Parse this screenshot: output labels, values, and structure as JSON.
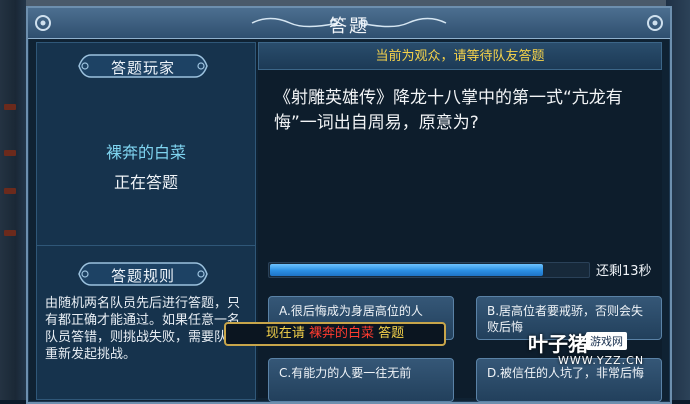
{
  "dialog": {
    "title": "答题"
  },
  "left_panel": {
    "player_header": "答题玩家",
    "player_name": "裸奔的白菜",
    "player_status": "正在答题",
    "rules_header": "答题规则",
    "rules_text": "由随机两名队员先后进行答题，只有都正确才能通过。如果任意一名队员答错，则挑战失败，需要队长重新发起挑战。"
  },
  "right_panel": {
    "notice": "当前为观众，请等待队友答题",
    "question": "《射雕英雄传》降龙十八掌中的第一式“亢龙有悔”一词出自周易，原意为?",
    "progress": 0.86,
    "time_left": "还剩13秒",
    "answers": [
      {
        "label": "A.很后悔成为身居高位的人"
      },
      {
        "label": "B.居高位者要戒骄，否则会失败后悔"
      },
      {
        "label": "C.有能力的人要一往无前"
      },
      {
        "label": "D.被信任的人坑了，非常后悔"
      }
    ]
  },
  "banner": {
    "prefix": "现在请 ",
    "name": "裸奔的白菜",
    "suffix": " 答题"
  },
  "watermark": {
    "title": "叶子猪",
    "tag": "游戏网",
    "url": "WWW.YZZ.CN"
  },
  "colors": {
    "accent_blue": "#2b8fe3",
    "notice_yellow": "#f5d24a",
    "player_cyan": "#7fd4f0",
    "banner_red": "#ff3b2f"
  }
}
